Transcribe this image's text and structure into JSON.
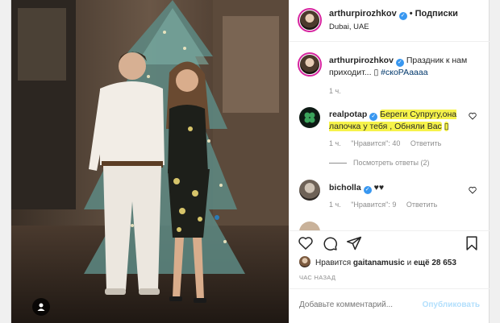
{
  "post": {
    "author": "arthurpirozhkov",
    "follow_label": "Подписки",
    "location": "Dubai, UAE",
    "caption_text": "Праздник к нам приходит...",
    "caption_hashtag": "#скоРАаааа",
    "caption_time": "1 ч.",
    "verified_glyph": "✓",
    "separator": "•",
    "emoji_placeholder": "▯"
  },
  "comments": [
    {
      "user": "realpotap",
      "text": "Береги Супругу,она лапочка у тебя , Обняли Вас",
      "time": "1 ч.",
      "likes": "\"Нравится\": 40",
      "reply": "Ответить",
      "view_replies": "Посмотреть ответы (2)",
      "highlight_color": "#f6f34a"
    },
    {
      "user": "bicholla",
      "text": "♥♥",
      "time": "1 ч.",
      "likes": "\"Нравится\": 9",
      "reply": "Ответить"
    }
  ],
  "likes_line": {
    "prefix": "Нравится",
    "user": "gaitanamusic",
    "conj": "и",
    "count_text": "ещё 28 653"
  },
  "time_ago": "ЧАС НАЗАД",
  "comment_input": {
    "placeholder": "Добавьте комментарий..."
  },
  "publish_label": "Опубликовать",
  "icons": [
    "heart-icon",
    "comment-icon",
    "share-icon",
    "bookmark-icon",
    "tag-user-icon",
    "more-icon"
  ],
  "colors": {
    "verified": "#3897f0",
    "link": "#00376b",
    "muted": "#8e8e8e",
    "publish_disabled": "#b2dffc"
  }
}
